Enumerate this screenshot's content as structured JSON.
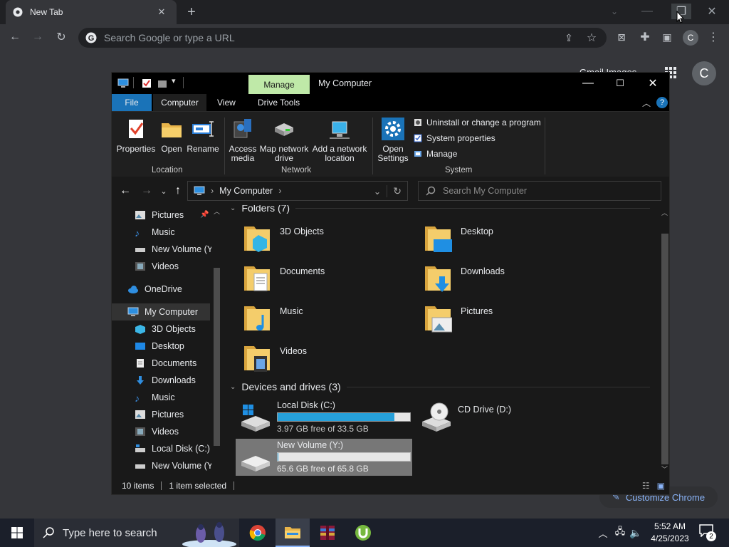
{
  "chrome": {
    "tab_title": "New Tab",
    "omnibox_placeholder": "Search Google or type a URL",
    "profile_initial": "C",
    "ntp_links": "Gmail   Images",
    "ntp_profile_initial": "C",
    "customize_label": "Customize Chrome"
  },
  "explorer": {
    "title": "My Computer",
    "manage_tab": "Manage",
    "ribbon_tabs": [
      "File",
      "Computer",
      "View",
      "Drive Tools"
    ],
    "ribbon": {
      "properties": "Properties",
      "open": "Open",
      "rename": "Rename",
      "access_media": "Access\nmedia",
      "map_network_drive": "Map network\ndrive",
      "add_network_location": "Add a network\nlocation",
      "open_settings": "Open\nSettings",
      "uninstall": "Uninstall or change a program",
      "system_properties": "System properties",
      "manage": "Manage",
      "group_location": "Location",
      "group_network": "Network",
      "group_system": "System"
    },
    "address": "My Computer",
    "search_placeholder": "Search My Computer",
    "nav_items": [
      "Pictures",
      "Music",
      "New Volume (Y:)",
      "Videos",
      "OneDrive",
      "My Computer",
      "3D Objects",
      "Desktop",
      "Documents",
      "Downloads",
      "Music",
      "Pictures",
      "Videos",
      "Local Disk (C:)",
      "New Volume (Y:)"
    ],
    "folders_header": "Folders (7)",
    "folders": [
      "3D Objects",
      "Desktop",
      "Documents",
      "Downloads",
      "Music",
      "Pictures",
      "Videos"
    ],
    "devices_header": "Devices and drives (3)",
    "drives": [
      {
        "name": "Local Disk (C:)",
        "free": "3.97 GB free of 33.5 GB",
        "used_fraction": 0.88
      },
      {
        "name": "CD Drive (D:)"
      },
      {
        "name": "New Volume (Y:)",
        "free": "65.6 GB free of 65.8 GB",
        "used_fraction": 0.003
      }
    ],
    "status_items": "10 items",
    "status_selected": "1 item selected"
  },
  "taskbar": {
    "search_placeholder": "Type here to search",
    "time": "5:52 AM",
    "date": "4/25/2023",
    "notification_count": "2"
  }
}
